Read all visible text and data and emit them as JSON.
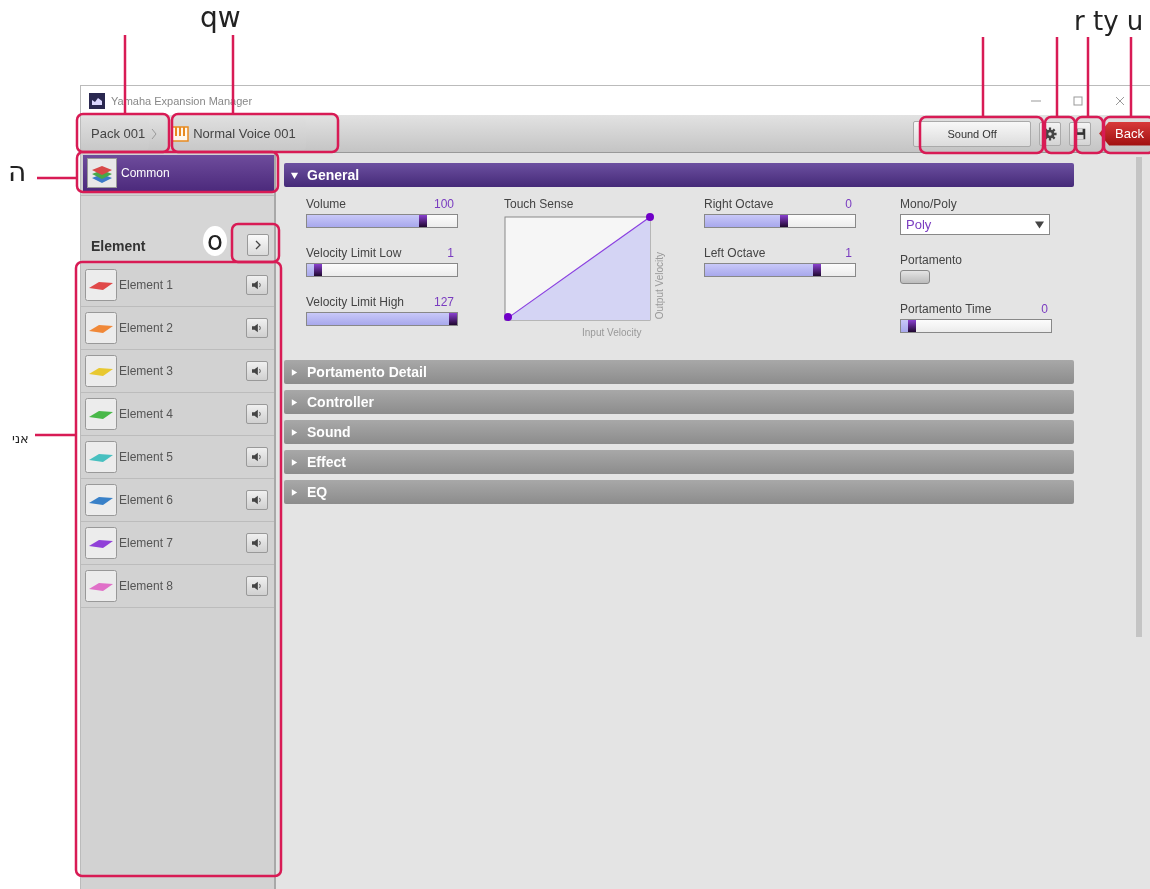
{
  "callouts": [
    {
      "text": "qw"
    },
    {
      "text": "r ty u"
    },
    {
      "text": "ה"
    },
    {
      "text": "o"
    },
    {
      "text": "אני"
    }
  ],
  "window": {
    "title": "Yamaha Expansion Manager"
  },
  "breadcrumb": [
    {
      "label": "Pack 001",
      "kind": "pack"
    },
    {
      "label": "Normal Voice 001",
      "kind": "voice"
    }
  ],
  "toolbar": {
    "sound_button": "Sound Off",
    "back_button": "Back"
  },
  "sidebar": {
    "common": {
      "label": "Common",
      "selected": true
    },
    "element_heading": "Element",
    "elements": [
      {
        "label": "Element 1",
        "color": "#e04848"
      },
      {
        "label": "Element 2",
        "color": "#f08838"
      },
      {
        "label": "Element 3",
        "color": "#e8c830"
      },
      {
        "label": "Element 4",
        "color": "#48b848"
      },
      {
        "label": "Element 5",
        "color": "#48c0c0"
      },
      {
        "label": "Element 6",
        "color": "#3880c8"
      },
      {
        "label": "Element 7",
        "color": "#9040d8"
      },
      {
        "label": "Element 8",
        "color": "#e070c8"
      }
    ]
  },
  "general": {
    "title": "General",
    "expanded": true,
    "left_sliders": [
      {
        "label": "Volume",
        "reading": "100",
        "level": 0.79
      },
      {
        "label": "Velocity Limit Low",
        "reading": "1",
        "level": 0.05
      },
      {
        "label": "Velocity Limit High",
        "reading": "127",
        "level": 1
      }
    ],
    "touch_sense": {
      "label": "Touch Sense",
      "y_label": "Output Velocity",
      "x_label": "Input Velocity"
    },
    "octave_sliders": [
      {
        "label": "Right Octave",
        "reading": "0",
        "level": 0.53
      },
      {
        "label": "Left Octave",
        "reading": "1",
        "level": 0.76
      }
    ],
    "mono_poly": {
      "label": "Mono/Poly",
      "value": "Poly"
    },
    "portamento": {
      "label": "Portamento",
      "on": false
    },
    "portamento_time": {
      "label": "Portamento Time",
      "reading": "0",
      "level": 0.05
    }
  },
  "sections": [
    {
      "title": "Portamento Detail",
      "expanded": false
    },
    {
      "title": "Controller",
      "expanded": false
    },
    {
      "title": "Sound",
      "expanded": false
    },
    {
      "title": "Effect",
      "expanded": false
    },
    {
      "title": "EQ",
      "expanded": false
    }
  ]
}
